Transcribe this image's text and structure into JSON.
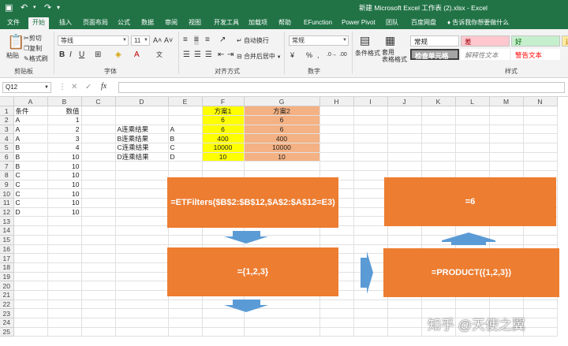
{
  "window": {
    "title": "新建 Microsoft Excel 工作表 (2).xlsx  -  Excel"
  },
  "tabs": [
    "文件",
    "开始",
    "插入",
    "页面布局",
    "公式",
    "数据",
    "审阅",
    "视图",
    "开发工具",
    "加载项",
    "帮助",
    "EFunction",
    "Power Pivot",
    "团队",
    "百度网盘"
  ],
  "tell_me": "告诉我你想要做什么",
  "ribbon": {
    "paste": "粘贴",
    "cut": "剪切",
    "copy": "复制",
    "format_painter": "格式刷",
    "clipboard_label": "剪贴板",
    "font_name": "等线",
    "font_size": "11",
    "font_label": "字体",
    "wrap_text": "自动换行",
    "merge_center": "合并后居中",
    "align_label": "对齐方式",
    "number_format": "常规",
    "number_label": "数字",
    "cond_format": "条件格式",
    "table_format": "套用\n表格格式",
    "styles_label": "样式",
    "style_normal": "常规",
    "style_bad": "差",
    "style_good": "好",
    "style_check": "检查单元格",
    "style_explain": "解释性文本",
    "style_warning": "警告文本",
    "style_cut": "适"
  },
  "namebox": "Q12",
  "columns": [
    "A",
    "B",
    "C",
    "D",
    "E",
    "F",
    "G",
    "H",
    "I",
    "J",
    "K",
    "L",
    "M",
    "N"
  ],
  "rows": [
    [
      "条件",
      "数值",
      "",
      "",
      "",
      "方案1",
      "方案2",
      "",
      "",
      "",
      "",
      "",
      "",
      ""
    ],
    [
      "A",
      "1",
      "",
      "",
      "",
      "6",
      "6",
      "",
      "",
      "",
      "",
      "",
      "",
      ""
    ],
    [
      "A",
      "2",
      "",
      "A连乘结果",
      "A",
      "6",
      "6",
      "",
      "",
      "",
      "",
      "",
      "",
      ""
    ],
    [
      "A",
      "3",
      "",
      "B连乘结果",
      "B",
      "400",
      "400",
      "",
      "",
      "",
      "",
      "",
      "",
      ""
    ],
    [
      "B",
      "4",
      "",
      "C连乘结果",
      "C",
      "10000",
      "10000",
      "",
      "",
      "",
      "",
      "",
      "",
      ""
    ],
    [
      "B",
      "10",
      "",
      "D连乘结果",
      "D",
      "10",
      "10",
      "",
      "",
      "",
      "",
      "",
      "",
      ""
    ],
    [
      "B",
      "10",
      "",
      "",
      "",
      "",
      "",
      "",
      "",
      "",
      "",
      "",
      "",
      ""
    ],
    [
      "C",
      "10",
      "",
      "",
      "",
      "",
      "",
      "",
      "",
      "",
      "",
      "",
      "",
      ""
    ],
    [
      "C",
      "10",
      "",
      "",
      "",
      "",
      "",
      "",
      "",
      "",
      "",
      "",
      "",
      ""
    ],
    [
      "C",
      "10",
      "",
      "",
      "",
      "",
      "",
      "",
      "",
      "",
      "",
      "",
      "",
      ""
    ],
    [
      "C",
      "10",
      "",
      "",
      "",
      "",
      "",
      "",
      "",
      "",
      "",
      "",
      "",
      ""
    ],
    [
      "D",
      "10",
      "",
      "",
      "",
      "",
      "",
      "",
      "",
      "",
      "",
      "",
      "",
      ""
    ],
    [
      "",
      "",
      "",
      "",
      "",
      "",
      "",
      "",
      "",
      "",
      "",
      "",
      "",
      ""
    ],
    [
      "",
      "",
      "",
      "",
      "",
      "",
      "",
      "",
      "",
      "",
      "",
      "",
      "",
      ""
    ],
    [
      "",
      "",
      "",
      "",
      "",
      "",
      "",
      "",
      "",
      "",
      "",
      "",
      "",
      ""
    ],
    [
      "",
      "",
      "",
      "",
      "",
      "",
      "",
      "",
      "",
      "",
      "",
      "",
      "",
      ""
    ],
    [
      "",
      "",
      "",
      "",
      "",
      "",
      "",
      "",
      "",
      "",
      "",
      "",
      "",
      ""
    ],
    [
      "",
      "",
      "",
      "",
      "",
      "",
      "",
      "",
      "",
      "",
      "",
      "",
      "",
      ""
    ],
    [
      "",
      "",
      "",
      "",
      "",
      "",
      "",
      "",
      "",
      "",
      "",
      "",
      "",
      ""
    ],
    [
      "",
      "",
      "",
      "",
      "",
      "",
      "",
      "",
      "",
      "",
      "",
      "",
      "",
      ""
    ],
    [
      "",
      "",
      "",
      "",
      "",
      "",
      "",
      "",
      "",
      "",
      "",
      "",
      "",
      ""
    ],
    [
      "",
      "",
      "",
      "",
      "",
      "",
      "",
      "",
      "",
      "",
      "",
      "",
      "",
      ""
    ],
    [
      "",
      "",
      "",
      "",
      "",
      "",
      "",
      "",
      "",
      "",
      "",
      "",
      "",
      ""
    ],
    [
      "",
      "",
      "",
      "",
      "",
      "",
      "",
      "",
      "",
      "",
      "",
      "",
      "",
      ""
    ],
    [
      "",
      "",
      "",
      "",
      "",
      "",
      "",
      "",
      "",
      "",
      "",
      "",
      "",
      ""
    ]
  ],
  "shapes": {
    "box1": "=ETFilters($B$2:$B$12,$A$2:$A$12=E3)",
    "box2": "={1,2,3}",
    "box3": "=PRODUCT({1,2,3})",
    "box4": "=6"
  },
  "watermark": "知乎 @天使之翼",
  "colors": {
    "excel_green": "#217346",
    "shape_orange": "#ed7d31",
    "arrow_blue": "#5b9bd5",
    "yellow": "#ffff00",
    "salmon": "#f4b183"
  }
}
